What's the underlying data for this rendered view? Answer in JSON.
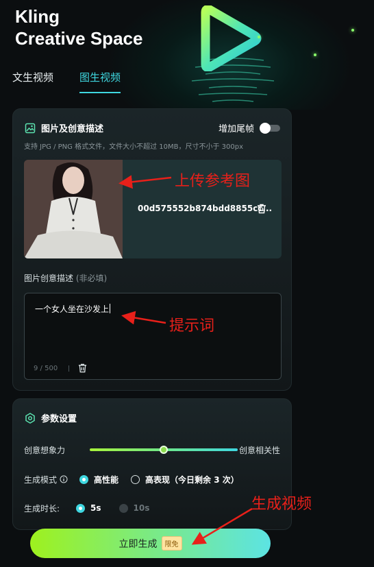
{
  "hero": {
    "title_line1": "Kling",
    "title_line2": "Creative Space"
  },
  "tabs": [
    {
      "label": "文生视频",
      "active": false
    },
    {
      "label": "图生视频",
      "active": true
    }
  ],
  "image_section": {
    "title": "图片及创意描述",
    "tail_frame_label": "增加尾帧",
    "tail_frame_on": false,
    "hint": "支持 JPG / PNG 格式文件，文件大小不超过 10MB，尺寸不小于 300px",
    "file_name": "00d575552b874bdd8855cc..."
  },
  "prompt": {
    "label": "图片创意描述",
    "optional": "(非必填)",
    "value": "一个女人坐在沙发上",
    "counter": "9 / 500"
  },
  "params": {
    "title": "参数设置",
    "slider_left": "创意想象力",
    "slider_right": "创意相关性",
    "slider_value": 0.5,
    "mode_label": "生成模式",
    "mode_options": [
      "高性能",
      "高表现（今日剩余 3 次）"
    ],
    "mode_selected": "高性能",
    "duration_label": "生成时长:",
    "duration_options": [
      "5s",
      "10s"
    ],
    "duration_selected": "5s"
  },
  "generate": {
    "label": "立即生成",
    "badge": "限免"
  },
  "annotations": {
    "upload": "上传参考图",
    "prompt": "提示词",
    "generate": "生成视频"
  },
  "colors": {
    "accent": "#3fd7e0",
    "annotation": "#e8201a",
    "button_start": "#9ef11e",
    "button_end": "#5ce3e3"
  }
}
